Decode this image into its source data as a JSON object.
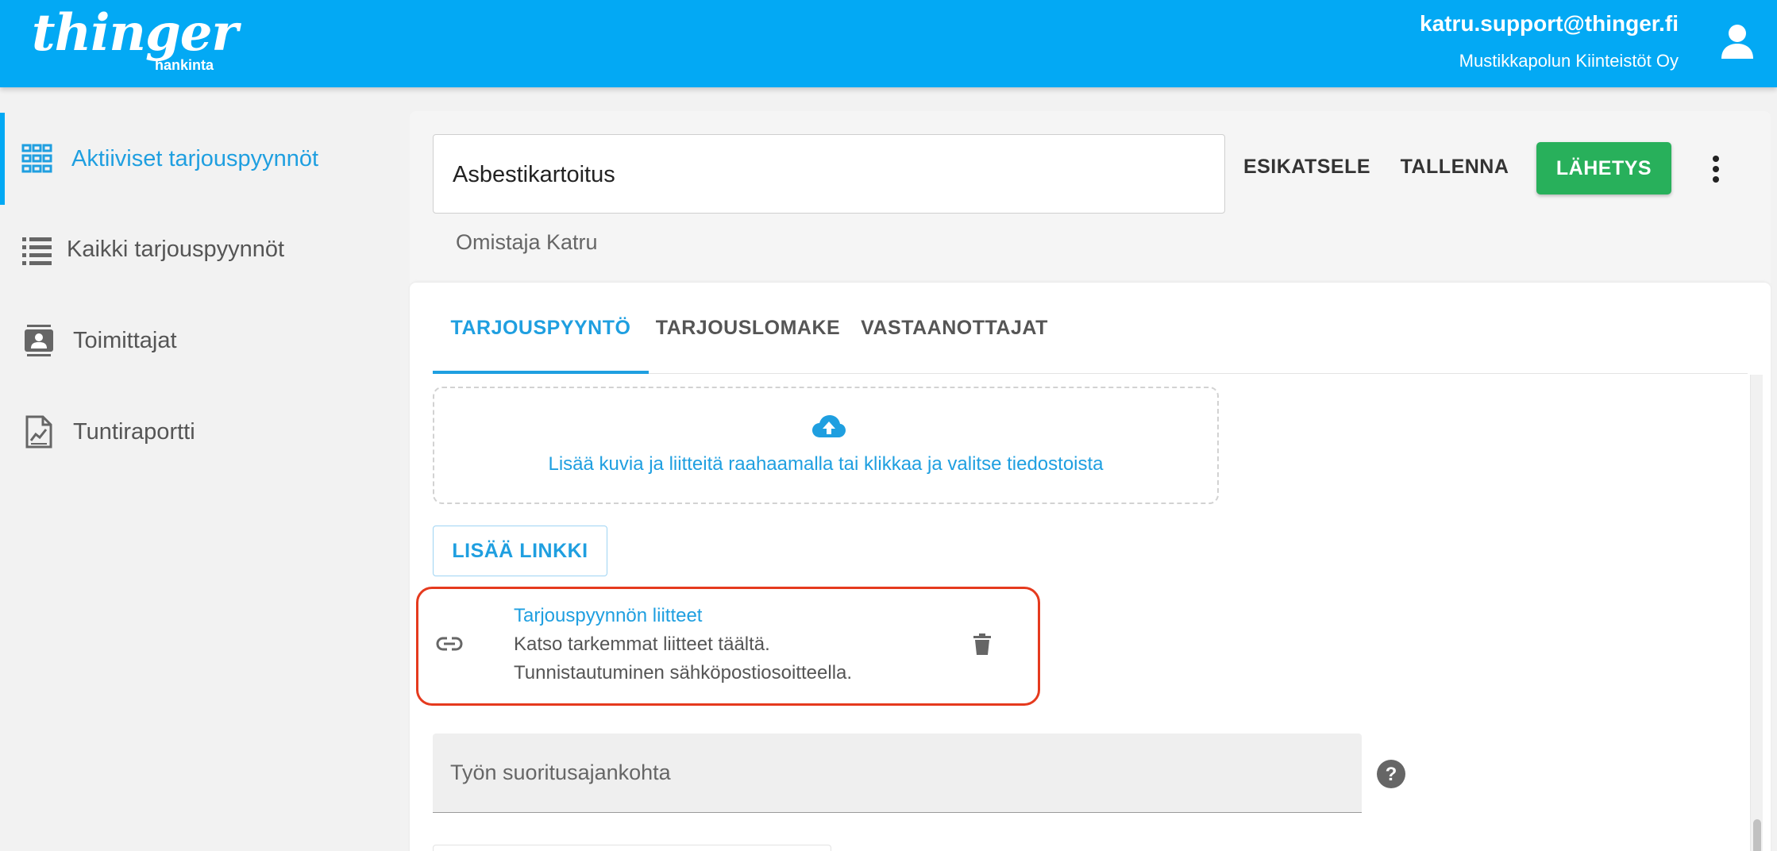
{
  "header": {
    "logo_text": "thinger",
    "logo_sub": "hankinta",
    "user_email": "katru.support@thinger.fi",
    "organization": "Mustikkapolun Kiinteistöt Oy",
    "accent_color": "#03a9f4"
  },
  "sidebar": {
    "items": [
      {
        "label": "Aktiiviset tarjouspyynnöt",
        "icon": "grid-icon",
        "active": true
      },
      {
        "label": "Kaikki tarjouspyynnöt",
        "icon": "list-icon",
        "active": false
      },
      {
        "label": "Toimittajat",
        "icon": "contact-card-icon",
        "active": false
      },
      {
        "label": "Tuntiraportti",
        "icon": "report-chart-icon",
        "active": false
      }
    ]
  },
  "request": {
    "title": "Asbestikartoitus",
    "owner": "Omistaja Katru"
  },
  "actions": {
    "preview": "ESIKATSELE",
    "save": "TALLENNA",
    "send": "LÄHETYS",
    "send_color": "#28b05b"
  },
  "tabs": [
    {
      "label": "TARJOUSPYYNTÖ",
      "active": true
    },
    {
      "label": "TARJOUSLOMAKE",
      "active": false
    },
    {
      "label": "VASTAANOTTAJAT",
      "active": false
    }
  ],
  "upload": {
    "text": "Lisää kuvia ja liitteitä raahaamalla tai klikkaa ja valitse tiedostoista"
  },
  "add_link_label": "LISÄÄ LINKKI",
  "attachment": {
    "title": "Tarjouspyynnön liitteet",
    "line1": "Katso tarkemmat liitteet täältä.",
    "line2": "Tunnistautuminen sähköpostiosoitteella.",
    "highlight_color": "#e53a1e"
  },
  "fields": {
    "work_time_label": "Työn suoritusajankohta"
  }
}
